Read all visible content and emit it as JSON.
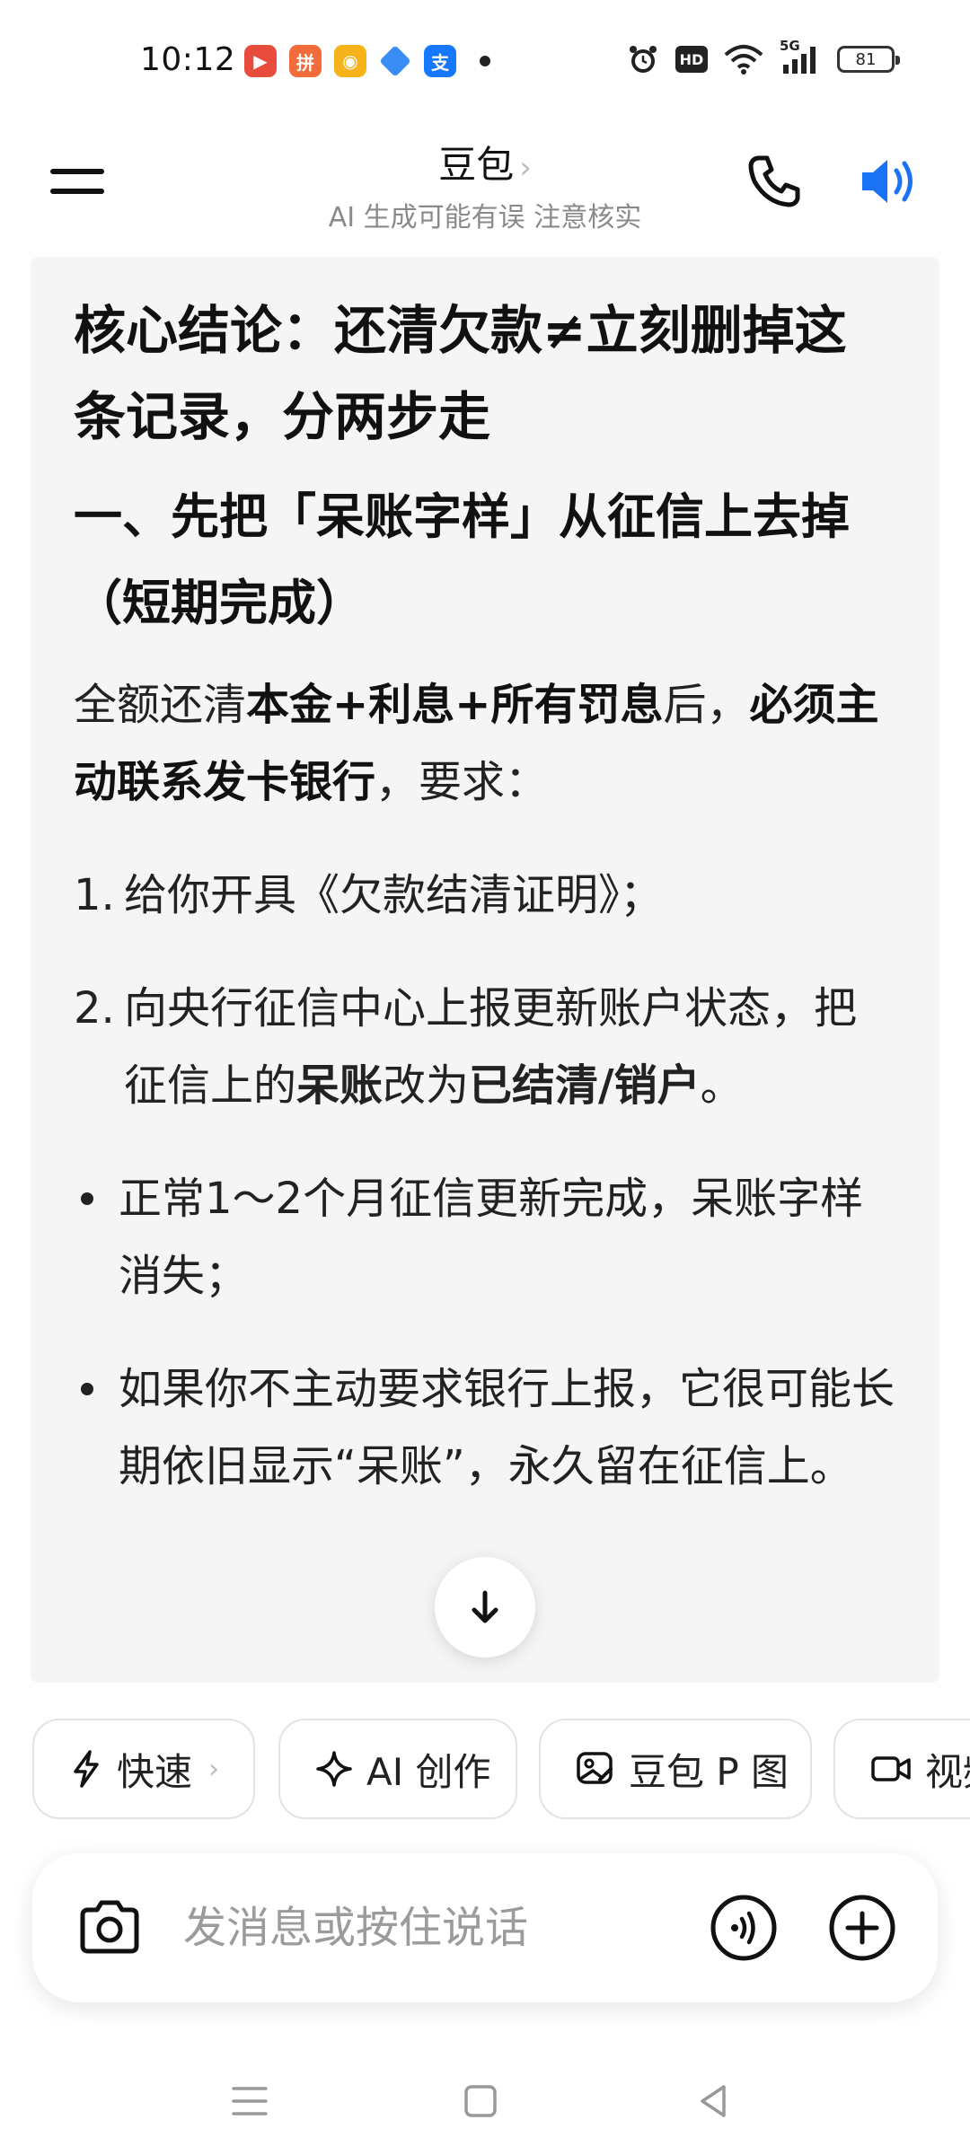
{
  "status_bar": {
    "time": "10:12",
    "battery": "81",
    "network": "5G",
    "hd": "HD",
    "app_icons": [
      "video-app-icon",
      "shopping-app-icon",
      "weibo-icon",
      "blue-app-icon",
      "alipay-icon"
    ]
  },
  "header": {
    "title": "豆包",
    "title_chevron": "›",
    "subtitle": "AI 生成可能有误 注意核实"
  },
  "message": {
    "heading": "核心结论：还清欠款≠立刻删掉这条记录，分两步走",
    "section_title": "一、先把「呆账字样」从征信上去掉（短期完成）",
    "intro": {
      "p1": "全额还清",
      "b1": "本金+利息+所有罚息",
      "p2": "后，",
      "b2": "必须主动联系发卡银行",
      "p3": "，要求："
    },
    "ordered": [
      {
        "num": "1.",
        "text": "给你开具《欠款结清证明》；"
      },
      {
        "num": "2.",
        "p1": "向央行征信中心上报更新账户状态，把征信上的",
        "b1": "呆账",
        "p2": "改为",
        "b2": "已结清/销户",
        "p3": "。"
      }
    ],
    "bullets": [
      "正常1～2个月征信更新完成，呆账字样消失；",
      "如果你不主动要求银行上报，它很可能长期依旧显示“呆账”，永久留在征信上。"
    ]
  },
  "chips": [
    {
      "label": "快速",
      "icon": "lightning-icon",
      "chevron": "›"
    },
    {
      "label": "AI 创作",
      "icon": "sparkle-icon"
    },
    {
      "label": "豆包 P 图",
      "icon": "image-edit-icon"
    },
    {
      "label": "视频",
      "icon": "video-camera-icon"
    }
  ],
  "input": {
    "placeholder": "发消息或按住说话"
  },
  "colors": {
    "accent": "#1a73f5",
    "card_bg": "#f5f5f5",
    "text": "#111111",
    "muted": "#8a8a8a"
  }
}
